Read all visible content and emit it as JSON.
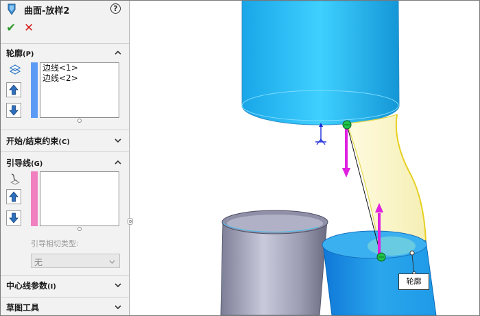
{
  "feature": {
    "title": "曲面-放样2",
    "help_icon": "help-icon",
    "ok_icon": "checkmark-icon",
    "cancel_icon": "close-icon"
  },
  "profiles": {
    "header": "轮廓",
    "key": "(P)",
    "items": [
      "边线<1>",
      "边线<2>"
    ],
    "bar_color": "#5b9bf5"
  },
  "start_end": {
    "header": "开始/结束约束",
    "key": "(C)"
  },
  "guides": {
    "header": "引导线",
    "key": "(G)",
    "items": [],
    "bar_color": "#f080c0",
    "tangency_label": "引导相切类型:",
    "tangency_value": "无"
  },
  "centerline": {
    "header": "中心线参数",
    "key": "(I)"
  },
  "sketch_tools": {
    "header": "草图工具"
  },
  "viewport": {
    "callout_label": "轮廓",
    "upper_cylinder_color": "#1fb4f0",
    "lower_cylinder_color": "#2aa6ec",
    "loft_color": "#fbf8c8",
    "arrow_color": "#e020e0",
    "point_color": "#1fc44a"
  },
  "icons": {
    "loft_feature": "surface-loft-icon",
    "profile_select": "profile-icon",
    "guide_select": "guide-curve-icon",
    "move_up": "arrow-up-icon",
    "move_down": "arrow-down-icon",
    "collapse": "chevron-up-icon",
    "expand": "chevron-down-icon"
  }
}
